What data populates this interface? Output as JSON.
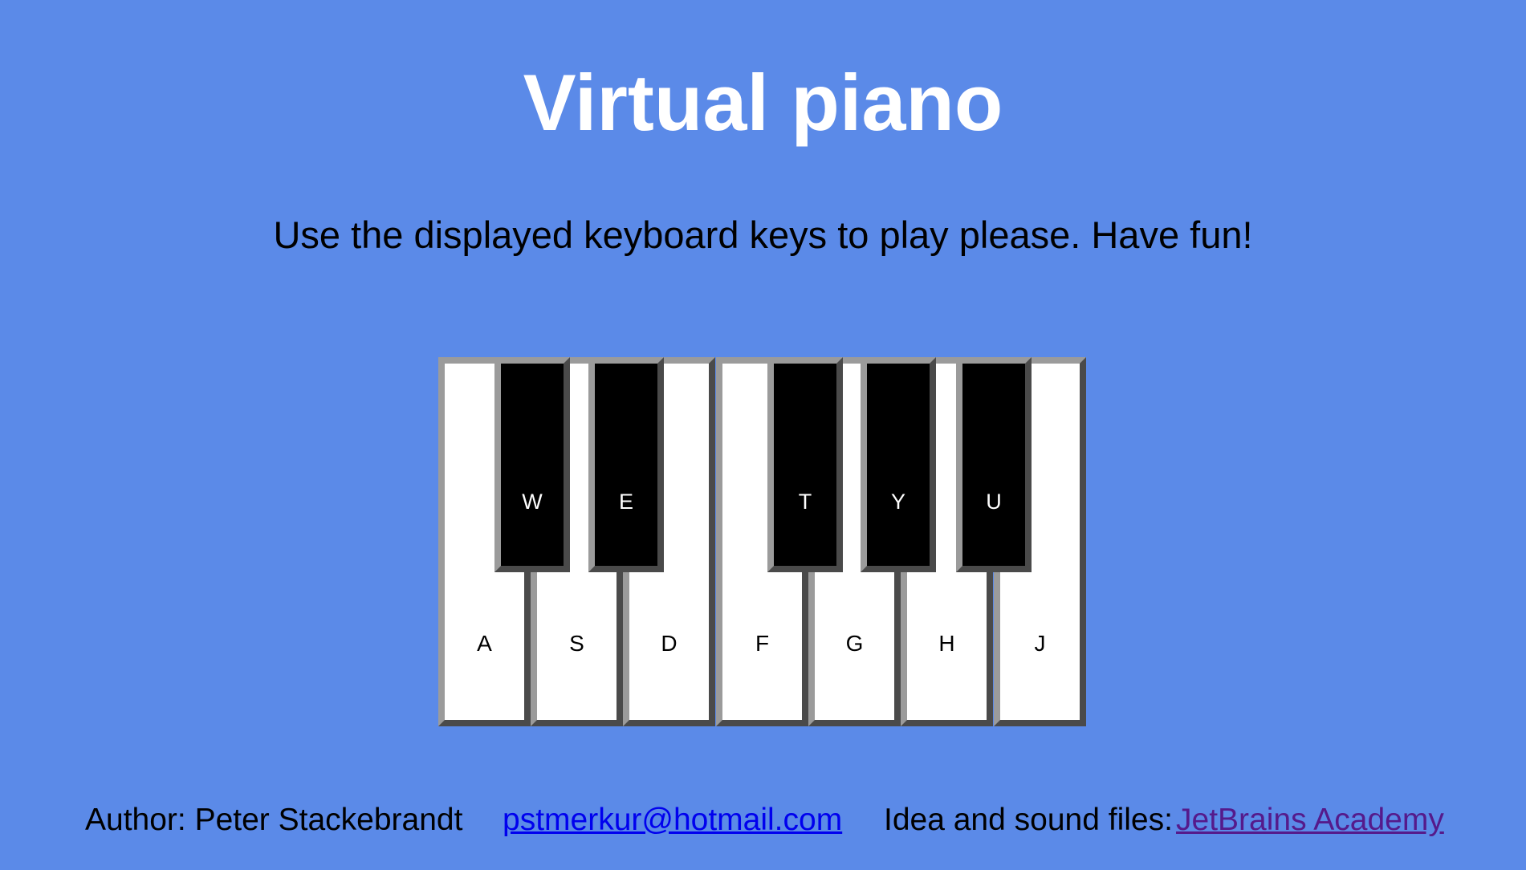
{
  "header": {
    "title": "Virtual piano",
    "subtitle": "Use the displayed keyboard keys to play please. Have fun!"
  },
  "piano": {
    "white_keys": [
      "A",
      "S",
      "D",
      "F",
      "G",
      "H",
      "J"
    ],
    "black_keys": [
      "W",
      "E",
      "T",
      "Y",
      "U"
    ]
  },
  "footer": {
    "author": "Author: Peter Stackebrandt",
    "email": "pstmerkur@hotmail.com",
    "credits_label": "Idea and sound files:",
    "credits_link": "JetBrains Academy"
  },
  "colors": {
    "background": "#5b8ae8",
    "title": "#ffffff",
    "white_key": "#ffffff",
    "black_key": "#000000",
    "key_border_light": "#9b9b9b",
    "key_border_dark": "#4a4a4a",
    "link": "#0000ee",
    "visited_link": "#551a8b"
  }
}
